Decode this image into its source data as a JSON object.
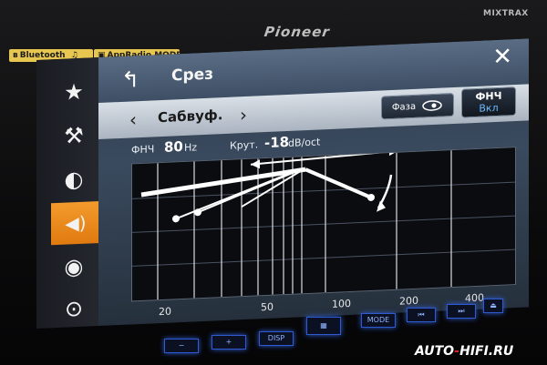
{
  "device": {
    "brand": "Pioneer",
    "brand_sub": "MIXTRAX",
    "bluetooth_label": "Bluetooth",
    "bluetooth_icon": "bluetooth-icon",
    "apparadio_label": "AppRadio MODE",
    "music_icon": "music-notes-icon"
  },
  "sidebar": {
    "items": [
      {
        "icon": "star-icon",
        "glyph": "★"
      },
      {
        "icon": "tools-icon",
        "glyph": "⚒"
      },
      {
        "icon": "disc-icon",
        "glyph": "◐"
      },
      {
        "icon": "speaker-icon",
        "glyph": "◀)"
      },
      {
        "icon": "cd-icon",
        "glyph": "◉"
      },
      {
        "icon": "usb-icon",
        "glyph": "⊙"
      }
    ]
  },
  "header": {
    "title": "Срез",
    "back_glyph": "↰",
    "close_glyph": "✕"
  },
  "subheader": {
    "prev_glyph": "‹",
    "channel": "Сабвуф.",
    "next_glyph": "›",
    "phase_label": "Фаза",
    "lpf_label": "ФНЧ",
    "lpf_state": "Вкл"
  },
  "params": {
    "lpf_key": "ФНЧ",
    "lpf_value": "80",
    "lpf_unit": "Hz",
    "slope_key": "Крут.",
    "slope_value": "-18",
    "slope_unit": "dB/oct"
  },
  "graph": {
    "x_ticks": [
      "20",
      "50",
      "100",
      "200",
      "400"
    ]
  },
  "hardware_buttons": [
    "−",
    "+",
    "DISP",
    "▦",
    "MODE",
    "⏮",
    "⏭",
    "⏏"
  ],
  "watermark": {
    "part1": "AUTO",
    "dash": "-",
    "part2": "HIFI.RU"
  }
}
